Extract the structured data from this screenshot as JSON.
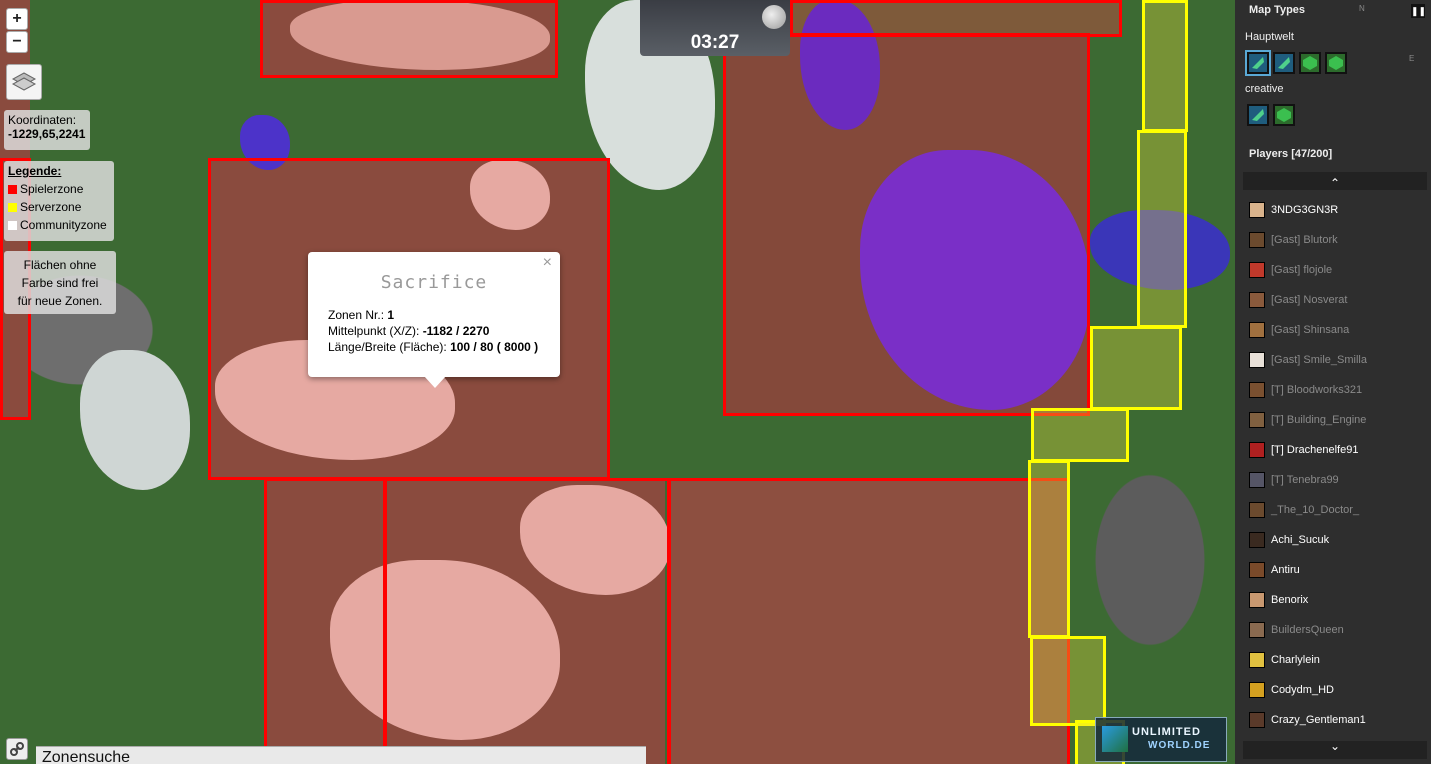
{
  "map": {
    "zoom_in_label": "+",
    "zoom_out_label": "−",
    "coords_label": "Koordinaten:",
    "coords_value": "-1229,65,2241",
    "legend": {
      "title": "Legende:",
      "items": [
        {
          "label": "Spielerzone",
          "color": "#ff0000"
        },
        {
          "label": "Serverzone",
          "color": "#ffff00"
        },
        {
          "label": "Communityzone",
          "color": "#ffffff"
        }
      ]
    },
    "free_text_lines": [
      "Flächen ohne",
      "Farbe sind frei",
      "für neue Zonen."
    ],
    "clock": {
      "time": "03:27"
    },
    "popup": {
      "title": "Sacrifice",
      "close_label": "×",
      "rows": [
        {
          "label": "Zonen Nr.: ",
          "value": "1"
        },
        {
          "label": "Mittelpunkt (X/Z): ",
          "value": "-1182 / 2270"
        },
        {
          "label": "Länge/Breite (Fläche): ",
          "value": "100 / 80 ( 8000 )"
        }
      ]
    },
    "search_label": "Zonensuche",
    "logo_text_top": "UNLIMITED",
    "logo_text_bottom": "WORLD.DE",
    "compass": {
      "n": "N",
      "e": "E"
    }
  },
  "sidebar": {
    "map_types_title": "Map Types",
    "pause_label": "❚❚",
    "worlds": [
      {
        "name": "Hauptwelt",
        "buttons": [
          "surface-map",
          "cave-map",
          "flat-map",
          "flat-map-2"
        ]
      },
      {
        "name": "creative",
        "buttons": [
          "surface-map",
          "flat-map"
        ]
      }
    ],
    "players_title": "Players [47/200]",
    "scroll_up": "⌃",
    "scroll_down": "⌄",
    "players": [
      {
        "name": "3NDG3GN3R",
        "dim": false,
        "head": "#d9b38c"
      },
      {
        "name": "[Gast] Blutork",
        "dim": true,
        "head": "#6b4a2e"
      },
      {
        "name": "[Gast] flojole",
        "dim": true,
        "head": "#c0392b"
      },
      {
        "name": "[Gast] Nosverat",
        "dim": true,
        "head": "#8a5a3c"
      },
      {
        "name": "[Gast] Shinsana",
        "dim": true,
        "head": "#a0703f"
      },
      {
        "name": "[Gast] Smile_Smilla",
        "dim": true,
        "head": "#e8e0d8"
      },
      {
        "name": "[T] Bloodworks321",
        "dim": true,
        "head": "#7a5030"
      },
      {
        "name": "[T] Building_Engine",
        "dim": true,
        "head": "#806040"
      },
      {
        "name": "[T] Drachenelfe91",
        "dim": false,
        "head": "#b02020"
      },
      {
        "name": "[T] Tenebra99",
        "dim": true,
        "head": "#555566"
      },
      {
        "name": "_The_10_Doctor_",
        "dim": true,
        "head": "#6b4a2e"
      },
      {
        "name": "Achi_Sucuk",
        "dim": false,
        "head": "#3a2a20"
      },
      {
        "name": "Antiru",
        "dim": false,
        "head": "#7a4a2a"
      },
      {
        "name": "Benorix",
        "dim": false,
        "head": "#c89870"
      },
      {
        "name": "BuildersQueen",
        "dim": true,
        "head": "#8a6a50"
      },
      {
        "name": "Charlylein",
        "dim": false,
        "head": "#e0c040"
      },
      {
        "name": "Codydm_HD",
        "dim": false,
        "head": "#d4a020"
      },
      {
        "name": "Crazy_Gentleman1",
        "dim": false,
        "head": "#5a3a2a"
      }
    ]
  }
}
